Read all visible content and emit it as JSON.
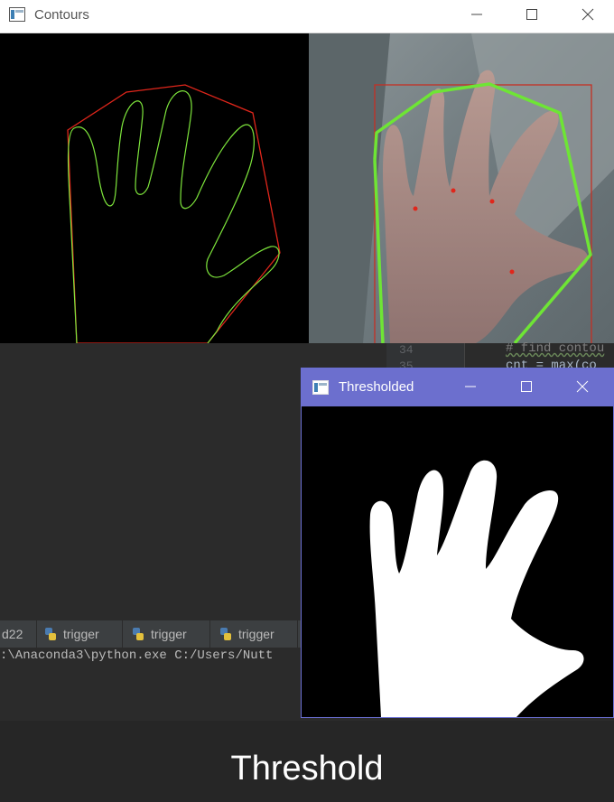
{
  "contours_window": {
    "title": "Contours",
    "controls": {
      "minimize": "—",
      "maximize": "☐",
      "close": "✕"
    }
  },
  "thresholded_window": {
    "title": "Thresholded",
    "controls": {
      "minimize": "—",
      "maximize": "☐",
      "close": "✕"
    }
  },
  "editor": {
    "line_numbers": [
      "34",
      "35"
    ],
    "code_lines": [
      "# find contou",
      "cnt = max(co"
    ]
  },
  "run_panel": {
    "tabs": [
      {
        "label": "d22"
      },
      {
        "label": "trigger"
      },
      {
        "label": "trigger"
      },
      {
        "label": "trigger"
      }
    ],
    "console_line": ":\\Anaconda3\\python.exe C:/Users/Nutt"
  },
  "caption": "Threshold",
  "colors": {
    "contour": "#7ee63c",
    "hull": "#e0261b",
    "thr_titlebar": "#6c6fce",
    "ide_bg": "#2b2b2b"
  },
  "icons": [
    "window-app-icon",
    "python-file-icon"
  ]
}
